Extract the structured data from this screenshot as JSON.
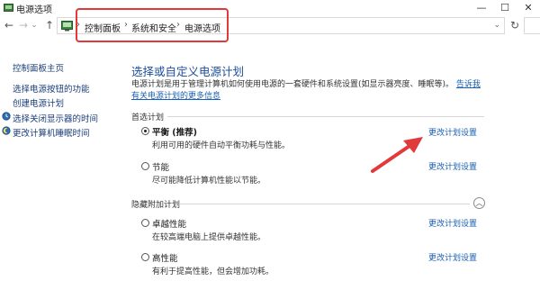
{
  "window": {
    "title": "电源选项",
    "min": "—",
    "max": "☐",
    "close": "✕"
  },
  "nav": {
    "back": "←",
    "forward": "→",
    "dropdown": "⌄",
    "up": "↑",
    "refresh": "↻"
  },
  "breadcrumb": {
    "items": [
      "控制面板",
      "系统和安全",
      "电源选项"
    ],
    "separator": "›"
  },
  "sidebar": {
    "items": [
      {
        "label": "控制面板主页"
      },
      {
        "label": "选择电源按钮的功能"
      },
      {
        "label": "创建电源计划"
      },
      {
        "label": "选择关闭显示器的时间"
      },
      {
        "label": "更改计算机睡眠时间"
      }
    ],
    "icons": [
      "clock-moon-icon",
      "moon-icon"
    ]
  },
  "main": {
    "heading": "选择或自定义电源计划",
    "description": "电源计划是用于管理计算机如何使用电源的一套硬件和系统设置(如显示器亮度、睡眠等)。",
    "learn_more": "告诉我有关电源计划的更多信息",
    "preferred_label": "首选计划",
    "hidden_label": "隐藏附加计划",
    "change_link": "更改计划设置",
    "plans": [
      {
        "name": "平衡 (推荐)",
        "description": "利用可用的硬件自动平衡功耗与性能。",
        "selected": true
      },
      {
        "name": "节能",
        "description": "尽可能降低计算机性能以节能。",
        "selected": false
      },
      {
        "name": "卓越性能",
        "description": "在较高端电脑上提供卓越性能。",
        "selected": false
      },
      {
        "name": "高性能",
        "description": "有利于提高性能，但会增加功耗。",
        "selected": false
      }
    ]
  },
  "colors": {
    "accent": "#1c4e9d",
    "link": "#1a5fb4",
    "annotation": "#e03a3a"
  }
}
